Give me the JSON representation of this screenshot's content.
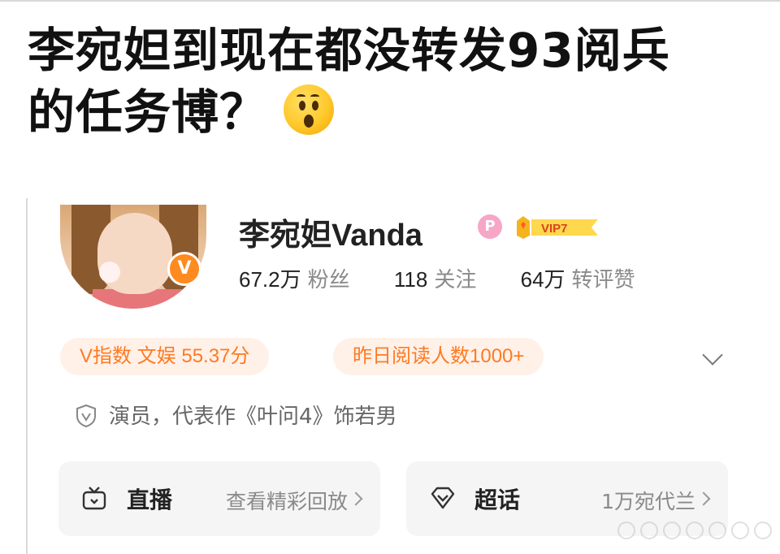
{
  "headline": {
    "line1": "李宛妲到现在都没转发93阅兵",
    "line2": "的任务博？",
    "emoji": "surprised-face-emoji"
  },
  "profile": {
    "name": "李宛妲Vanda",
    "verified_badge": "V",
    "pink_badge": "P",
    "vip_label": "VIP7",
    "stats": [
      {
        "num": "67.2万",
        "label": "粉丝"
      },
      {
        "num": "118",
        "label": "关注"
      },
      {
        "num": "64万",
        "label": "转评赞"
      }
    ],
    "pills": [
      "V指数 文娱 55.37分",
      "昨日阅读人数1000+"
    ],
    "bio": "演员，代表作《叶问4》饰若男",
    "tiles": [
      {
        "title": "直播",
        "sub": "查看精彩回放",
        "icon": "tv-icon"
      },
      {
        "title": "超话",
        "sub": "1万宛代兰",
        "icon": "diamond-icon"
      }
    ]
  },
  "colors": {
    "accent": "#ff7a22",
    "pill_bg": "#fff1e8",
    "vip": "#f5b41e",
    "muted": "#8a8a8a"
  }
}
